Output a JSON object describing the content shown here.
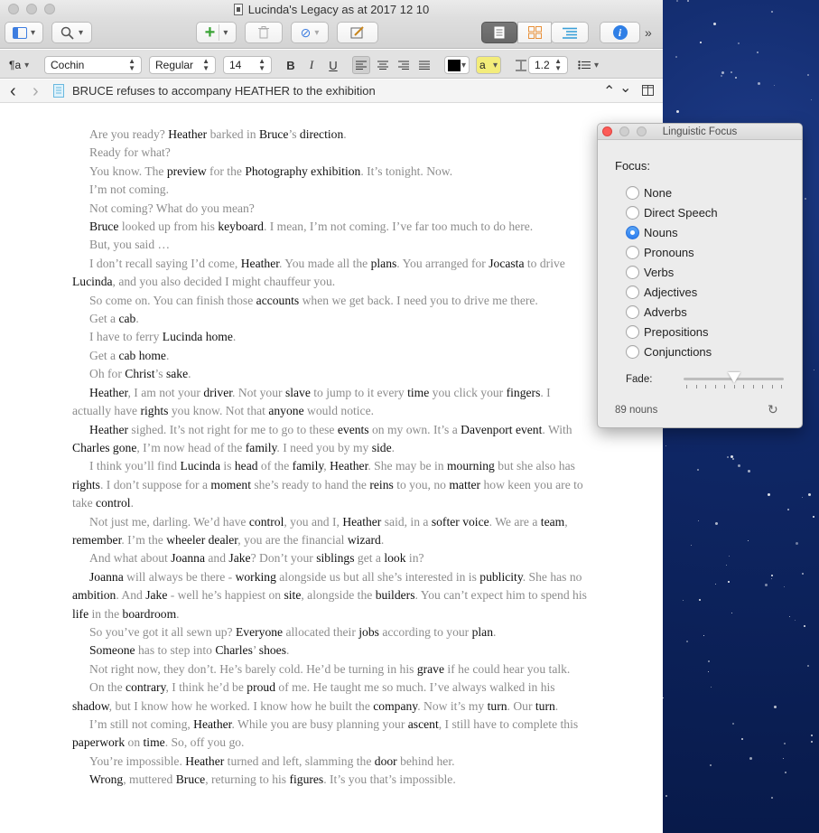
{
  "window": {
    "title": "Lucinda's Legacy as at 2017 12 10"
  },
  "toolbar": {
    "binder_icon": "binder-sidebar-icon",
    "search_icon": "search-icon",
    "add_icon": "plus-icon",
    "trash_icon": "trash-icon",
    "attach_icon": "paperclip-icon",
    "edit_icon": "compose-icon",
    "view_modes": [
      "document-view-icon",
      "corkboard-icon",
      "outline-icon"
    ],
    "info_icon": "info-icon",
    "overflow_label": "»",
    "accent_color": "#3d7de0"
  },
  "format": {
    "paragraph_style_label": "¶a",
    "font_family": "Cochin",
    "font_style": "Regular",
    "font_size": "14",
    "bold_label": "B",
    "italic_label": "I",
    "underline_label": "U",
    "text_color": "#000000",
    "highlight_label": "a",
    "highlight_color": "#f3ec7a",
    "line_spacing": "1.2"
  },
  "nav": {
    "back_label": "‹",
    "forward_label": "›",
    "document_title": "BRUCE refuses to accompany HEATHER to the exhibition",
    "up_label": "⌃",
    "down_label": "⌄"
  },
  "panel": {
    "title": "Linguistic Focus",
    "focus_label": "Focus:",
    "options": [
      "None",
      "Direct Speech",
      "Nouns",
      "Pronouns",
      "Verbs",
      "Adjectives",
      "Adverbs",
      "Prepositions",
      "Conjunctions"
    ],
    "selected": "Nouns",
    "fade_label": "Fade:",
    "fade_value": 0.5,
    "count_text": "89 nouns",
    "refresh_icon": "refresh-icon"
  },
  "editor": {
    "noun_color": "#111111",
    "faded_color": "#8c8c8c",
    "paragraphs": [
      [
        [
          "Are you ready? ",
          0
        ],
        [
          "Heather",
          1
        ],
        [
          " barked in ",
          0
        ],
        [
          "Bruce",
          1
        ],
        [
          "’s ",
          0
        ],
        [
          "direction",
          1
        ],
        [
          ".",
          0
        ]
      ],
      [
        [
          "Ready for what?",
          0
        ]
      ],
      [
        [
          "You know. The ",
          0
        ],
        [
          "preview",
          1
        ],
        [
          " for the ",
          0
        ],
        [
          "Photography exhibition",
          1
        ],
        [
          ". It’s tonight. Now.",
          0
        ]
      ],
      [
        [
          "I’m not coming.",
          0
        ]
      ],
      [
        [
          "Not coming? What do you mean?",
          0
        ]
      ],
      [
        [
          "Bruce",
          1
        ],
        [
          " looked up from his ",
          0
        ],
        [
          "keyboard",
          1
        ],
        [
          ". I mean, I’m not coming. I’ve far too much to do here.",
          0
        ]
      ],
      [
        [
          "But, you said …",
          0
        ]
      ],
      [
        [
          "I don’t recall saying I’d come, ",
          0
        ],
        [
          "Heather",
          1
        ],
        [
          ". You made all the ",
          0
        ],
        [
          "plans",
          1
        ],
        [
          ". You arranged for ",
          0
        ],
        [
          "Jocasta",
          1
        ],
        [
          " to drive ",
          0
        ],
        [
          "Lucinda",
          1
        ],
        [
          ", and you also decided I might chauffeur you.",
          0
        ]
      ],
      [
        [
          "So come on. You can finish those ",
          0
        ],
        [
          "accounts",
          1
        ],
        [
          " when we get back. I need you to drive me there.",
          0
        ]
      ],
      [
        [
          "Get a ",
          0
        ],
        [
          "cab",
          1
        ],
        [
          ".",
          0
        ]
      ],
      [
        [
          "I have to ferry ",
          0
        ],
        [
          "Lucinda home",
          1
        ],
        [
          ".",
          0
        ]
      ],
      [
        [
          "Get a ",
          0
        ],
        [
          "cab home",
          1
        ],
        [
          ".",
          0
        ]
      ],
      [
        [
          "Oh for ",
          0
        ],
        [
          "Christ",
          1
        ],
        [
          "’s ",
          0
        ],
        [
          "sake",
          1
        ],
        [
          ".",
          0
        ]
      ],
      [
        [
          "Heather",
          1
        ],
        [
          ", I am not your ",
          0
        ],
        [
          "driver",
          1
        ],
        [
          ". Not your ",
          0
        ],
        [
          "slave",
          1
        ],
        [
          " to jump to it every ",
          0
        ],
        [
          "time",
          1
        ],
        [
          " you click your ",
          0
        ],
        [
          "fingers",
          1
        ],
        [
          ". I actually have ",
          0
        ],
        [
          "rights",
          1
        ],
        [
          " you know. Not that ",
          0
        ],
        [
          "anyone",
          1
        ],
        [
          " would notice.",
          0
        ]
      ],
      [
        [
          "Heather",
          1
        ],
        [
          " sighed. It’s not right for me to go to these ",
          0
        ],
        [
          "events",
          1
        ],
        [
          " on my own. It’s a ",
          0
        ],
        [
          "Davenport event",
          1
        ],
        [
          ". With ",
          0
        ],
        [
          "Charles gone",
          1
        ],
        [
          ", I’m now head of the ",
          0
        ],
        [
          "family",
          1
        ],
        [
          ". I need you by my ",
          0
        ],
        [
          "side",
          1
        ],
        [
          ".",
          0
        ]
      ],
      [
        [
          "I think you’ll find ",
          0
        ],
        [
          "Lucinda",
          1
        ],
        [
          " is ",
          0
        ],
        [
          "head",
          1
        ],
        [
          " of the ",
          0
        ],
        [
          "family",
          1
        ],
        [
          ", ",
          0
        ],
        [
          "Heather",
          1
        ],
        [
          ". She may be in ",
          0
        ],
        [
          "mourning",
          1
        ],
        [
          " but she also has ",
          0
        ],
        [
          "rights",
          1
        ],
        [
          ". I don’t suppose for a ",
          0
        ],
        [
          "moment",
          1
        ],
        [
          " she’s ready to hand the ",
          0
        ],
        [
          "reins",
          1
        ],
        [
          " to you, no ",
          0
        ],
        [
          "matter",
          1
        ],
        [
          " how keen you are to take ",
          0
        ],
        [
          "control",
          1
        ],
        [
          ".",
          0
        ]
      ],
      [
        [
          "Not just me, darling. We’d have ",
          0
        ],
        [
          "control",
          1
        ],
        [
          ", you and I, ",
          0
        ],
        [
          "Heather",
          1
        ],
        [
          " said, in a ",
          0
        ],
        [
          "softer voice",
          1
        ],
        [
          ". We are a ",
          0
        ],
        [
          "team",
          1
        ],
        [
          ", ",
          0
        ],
        [
          "remember",
          1
        ],
        [
          ". I’m the ",
          0
        ],
        [
          "wheeler dealer",
          1
        ],
        [
          ", you are the financial ",
          0
        ],
        [
          "wizard",
          1
        ],
        [
          ".",
          0
        ]
      ],
      [
        [
          "And what about ",
          0
        ],
        [
          "Joanna",
          1
        ],
        [
          " and ",
          0
        ],
        [
          "Jake",
          1
        ],
        [
          "? Don’t your ",
          0
        ],
        [
          "siblings",
          1
        ],
        [
          " get a ",
          0
        ],
        [
          "look",
          1
        ],
        [
          " in?",
          0
        ]
      ],
      [
        [
          "Joanna",
          1
        ],
        [
          " will always be there - ",
          0
        ],
        [
          "working",
          1
        ],
        [
          " alongside us but all she’s interested in is ",
          0
        ],
        [
          "publicity",
          1
        ],
        [
          ". She has no ",
          0
        ],
        [
          "ambition",
          1
        ],
        [
          ". And ",
          0
        ],
        [
          "Jake",
          1
        ],
        [
          " - well he’s happiest on ",
          0
        ],
        [
          "site",
          1
        ],
        [
          ", alongside the ",
          0
        ],
        [
          "builders",
          1
        ],
        [
          ". You can’t expect him to spend his ",
          0
        ],
        [
          "life",
          1
        ],
        [
          " in the ",
          0
        ],
        [
          "boardroom",
          1
        ],
        [
          ".",
          0
        ]
      ],
      [
        [
          "So you’ve got it all sewn up? ",
          0
        ],
        [
          "Everyone",
          1
        ],
        [
          " allocated their ",
          0
        ],
        [
          "jobs",
          1
        ],
        [
          " according to your ",
          0
        ],
        [
          "plan",
          1
        ],
        [
          ".",
          0
        ]
      ],
      [
        [
          "Someone",
          1
        ],
        [
          " has to step into ",
          0
        ],
        [
          "Charles",
          1
        ],
        [
          "’ ",
          0
        ],
        [
          "shoes",
          1
        ],
        [
          ".",
          0
        ]
      ],
      [
        [
          "Not right now, they don’t. He’s barely cold. He’d be turning in his ",
          0
        ],
        [
          "grave",
          1
        ],
        [
          " if he could hear you talk.",
          0
        ]
      ],
      [
        [
          "On the ",
          0
        ],
        [
          "contrary",
          1
        ],
        [
          ", I think he’d be ",
          0
        ],
        [
          "proud",
          1
        ],
        [
          " of me. He taught me so much. I’ve always walked in his ",
          0
        ],
        [
          "shadow",
          1
        ],
        [
          ", but I know how he worked. I know how he built the ",
          0
        ],
        [
          "company",
          1
        ],
        [
          ". Now it’s my ",
          0
        ],
        [
          "turn",
          1
        ],
        [
          ". Our ",
          0
        ],
        [
          "turn",
          1
        ],
        [
          ".",
          0
        ]
      ],
      [
        [
          "I’m still not coming, ",
          0
        ],
        [
          "Heather",
          1
        ],
        [
          ". While you are busy planning your ",
          0
        ],
        [
          "ascent",
          1
        ],
        [
          ", I still have to complete this ",
          0
        ],
        [
          "paperwork",
          1
        ],
        [
          " on ",
          0
        ],
        [
          "time",
          1
        ],
        [
          ". So, off you go.",
          0
        ]
      ],
      [
        [
          "You’re impossible. ",
          0
        ],
        [
          "Heather",
          1
        ],
        [
          " turned and left, slamming the ",
          0
        ],
        [
          "door",
          1
        ],
        [
          " behind her.",
          0
        ]
      ],
      [
        [
          "Wrong",
          1
        ],
        [
          ", muttered ",
          0
        ],
        [
          "Bruce",
          1
        ],
        [
          ", returning to his ",
          0
        ],
        [
          "figures",
          1
        ],
        [
          ". It’s you that’s impossible.",
          0
        ]
      ]
    ]
  }
}
